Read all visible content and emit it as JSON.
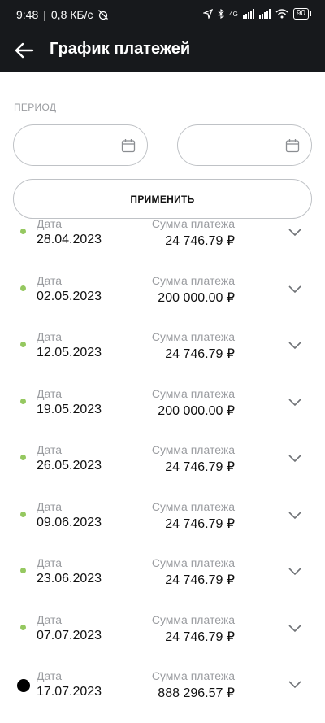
{
  "status_bar": {
    "time": "9:48",
    "speed": "0,8 КБ/с",
    "network_label": "4G",
    "battery": "90"
  },
  "header": {
    "title": "График платежей"
  },
  "filter": {
    "period_label": "ПЕРИОД",
    "date_from": "",
    "date_to": "",
    "apply_label": "ПРИМЕНИТЬ"
  },
  "payments": [
    {
      "date_label": "Дата",
      "date": "28.04.2023",
      "sum_label": "Сумма платежа",
      "sum": "24 746.79 ₽",
      "current": false
    },
    {
      "date_label": "Дата",
      "date": "02.05.2023",
      "sum_label": "Сумма платежа",
      "sum": "200 000.00 ₽",
      "current": false
    },
    {
      "date_label": "Дата",
      "date": "12.05.2023",
      "sum_label": "Сумма платежа",
      "sum": "24 746.79 ₽",
      "current": false
    },
    {
      "date_label": "Дата",
      "date": "19.05.2023",
      "sum_label": "Сумма платежа",
      "sum": "200 000.00 ₽",
      "current": false
    },
    {
      "date_label": "Дата",
      "date": "26.05.2023",
      "sum_label": "Сумма платежа",
      "sum": "24 746.79 ₽",
      "current": false
    },
    {
      "date_label": "Дата",
      "date": "09.06.2023",
      "sum_label": "Сумма платежа",
      "sum": "24 746.79 ₽",
      "current": false
    },
    {
      "date_label": "Дата",
      "date": "23.06.2023",
      "sum_label": "Сумма платежа",
      "sum": "24 746.79 ₽",
      "current": false
    },
    {
      "date_label": "Дата",
      "date": "07.07.2023",
      "sum_label": "Сумма платежа",
      "sum": "24 746.79 ₽",
      "current": false
    },
    {
      "date_label": "Дата",
      "date": "17.07.2023",
      "sum_label": "Сумма платежа",
      "sum": "888 296.57 ₽",
      "current": true
    }
  ],
  "colors": {
    "header_bg": "#17191c",
    "past_dot": "#95c860",
    "current_dot": "#000000",
    "muted_text": "#9a9ca0"
  }
}
